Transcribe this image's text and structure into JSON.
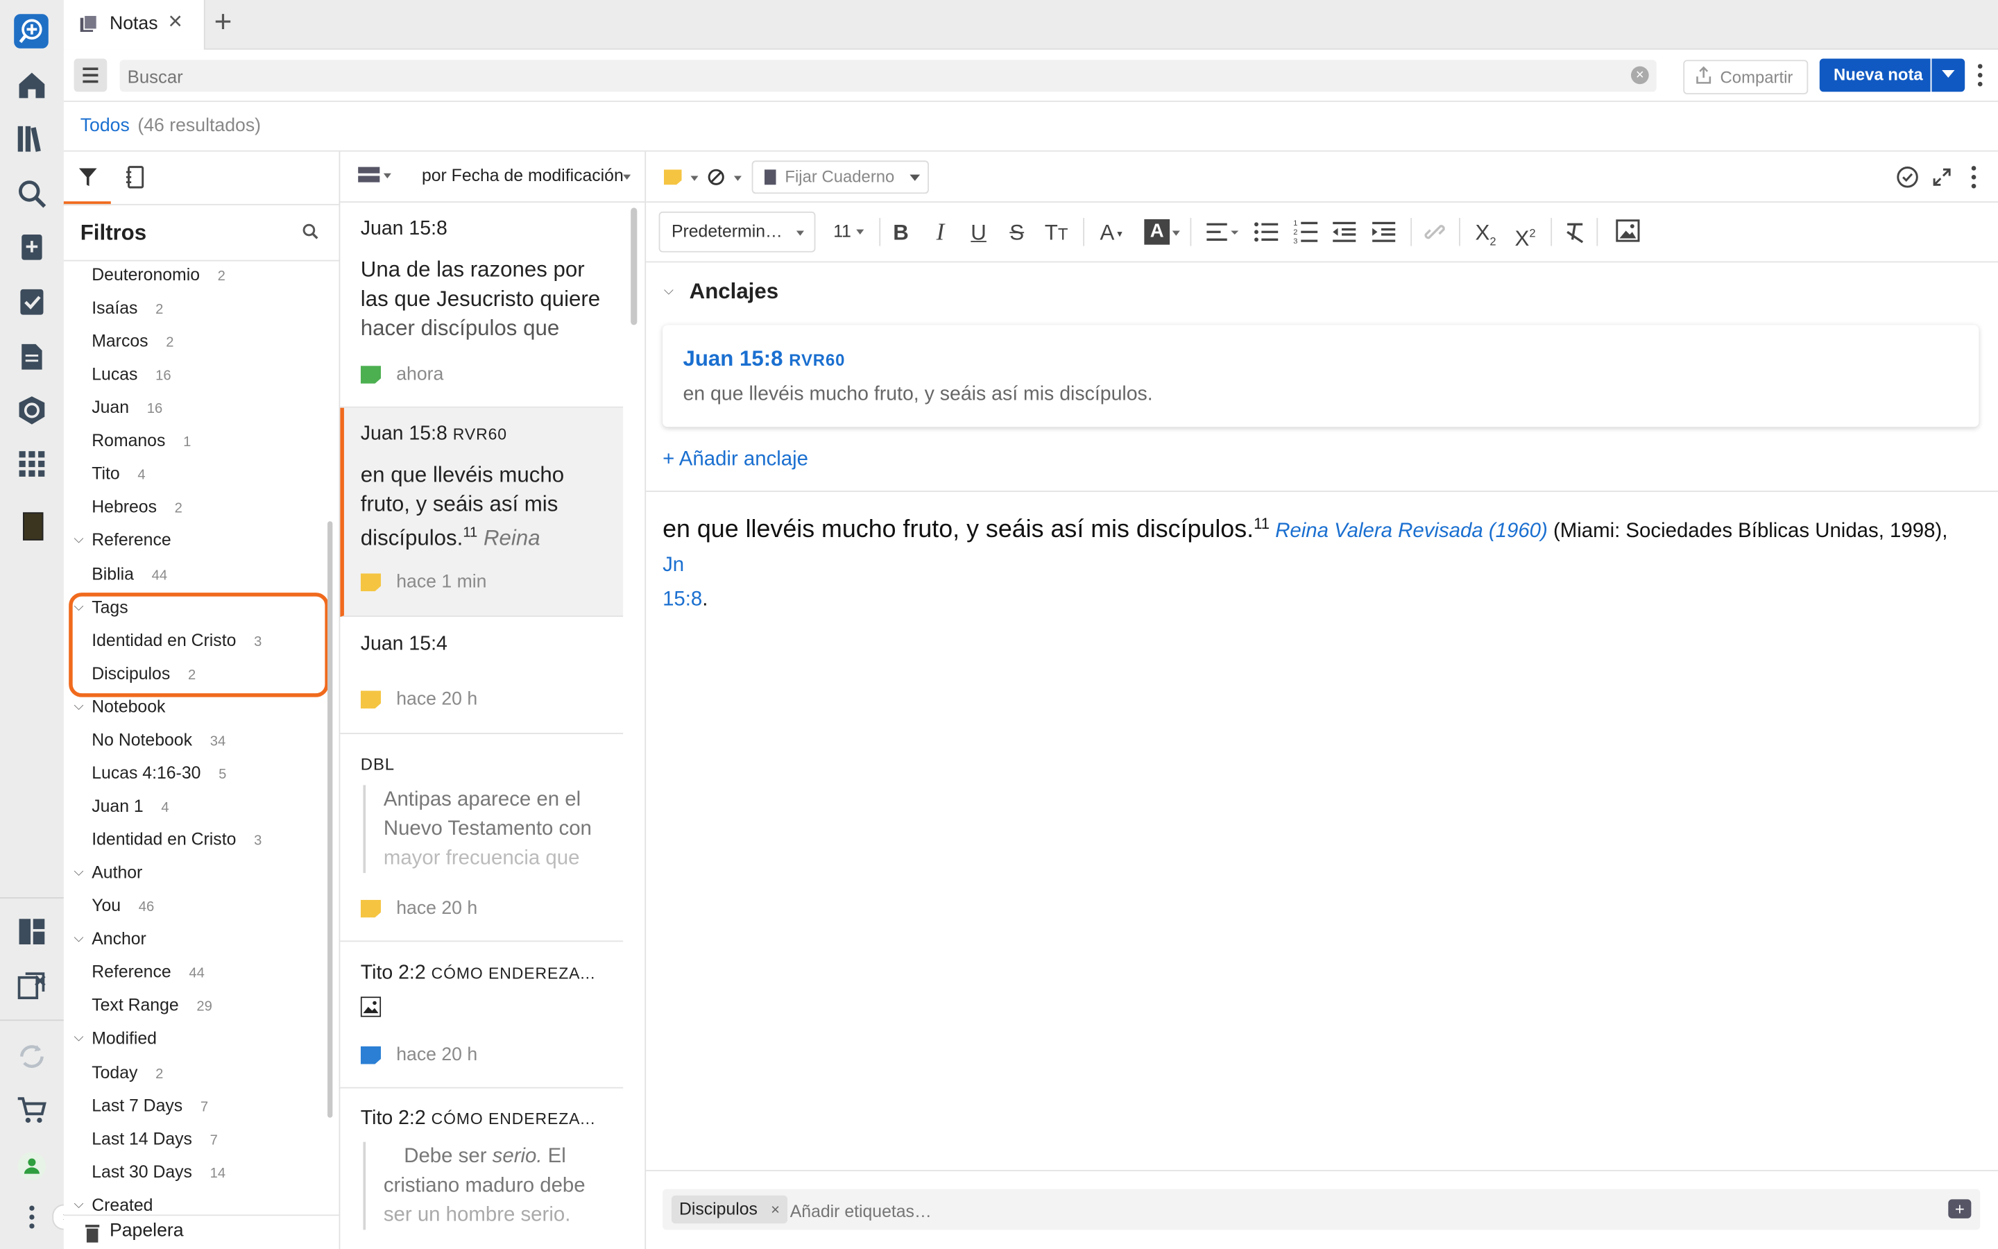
{
  "tab": {
    "title": "Notas"
  },
  "toolbar": {
    "search_placeholder": "Buscar",
    "share_label": "Compartir",
    "new_note_label": "Nueva nota"
  },
  "results": {
    "filter": "Todos",
    "count": "(46 resultados)"
  },
  "filters": {
    "title": "Filtros",
    "rows": [
      {
        "label": "Deuteronomio",
        "count": "2"
      },
      {
        "label": "Isaías",
        "count": "2"
      },
      {
        "label": "Marcos",
        "count": "2"
      },
      {
        "label": "Lucas",
        "count": "16"
      },
      {
        "label": "Juan",
        "count": "16"
      },
      {
        "label": "Romanos",
        "count": "1"
      },
      {
        "label": "Tito",
        "count": "4"
      },
      {
        "label": "Hebreos",
        "count": "2"
      },
      {
        "label": "Reference",
        "count": ""
      },
      {
        "label": "Biblia",
        "count": "44"
      },
      {
        "label": "Tags",
        "count": ""
      },
      {
        "label": "Identidad en Cristo",
        "count": "3"
      },
      {
        "label": "Discipulos",
        "count": "2"
      },
      {
        "label": "Notebook",
        "count": ""
      },
      {
        "label": "No Notebook",
        "count": "34"
      },
      {
        "label": "Lucas 4:16-30",
        "count": "5"
      },
      {
        "label": "Juan 1",
        "count": "4"
      },
      {
        "label": "Identidad en Cristo",
        "count": "3"
      },
      {
        "label": "Author",
        "count": ""
      },
      {
        "label": "You",
        "count": "46"
      },
      {
        "label": "Anchor",
        "count": ""
      },
      {
        "label": "Reference",
        "count": "44"
      },
      {
        "label": "Text Range",
        "count": "29"
      },
      {
        "label": "Modified",
        "count": ""
      },
      {
        "label": "Today",
        "count": "2"
      },
      {
        "label": "Last 7 Days",
        "count": "7"
      },
      {
        "label": "Last 14 Days",
        "count": "7"
      },
      {
        "label": "Last 30 Days",
        "count": "14"
      },
      {
        "label": "Created",
        "count": ""
      }
    ],
    "trash_label": "Papelera"
  },
  "notes_list": {
    "sort_label": "por Fecha de modificación",
    "items": [
      {
        "ref": "Juan 15:8",
        "ref_sc": "",
        "body_l1": "Una de las razones por",
        "body_l2": "las que Jesucristo quiere",
        "body_l3": "hacer discípulos que",
        "time": "ahora",
        "color": "#4caf50"
      },
      {
        "ref": "Juan 15:8",
        "ref_sc": "RVR60",
        "body_l1": "en que llevéis mucho",
        "body_l2": "fruto, y seáis así mis",
        "body_l3": "discípulos.",
        "body_l3_sup": "11",
        "body_l3_it": "Reina",
        "time": "hace 1 min",
        "color": "#f5c542"
      },
      {
        "ref": "Juan 15:4",
        "ref_sc": "",
        "time": "hace 20 h",
        "color": "#f5c542"
      },
      {
        "ref": "",
        "ref_sc": "DBL",
        "quote_l1": "Antipas aparece en el",
        "quote_l2": "Nuevo Testamento con",
        "quote_l3": "mayor frecuencia que",
        "time": "hace 20 h",
        "color": "#f5c542"
      },
      {
        "ref": "Tito 2:2",
        "ref_sc": "CÓMO ENDEREZA...",
        "time": "hace 20 h",
        "color": "#2b7fd4"
      },
      {
        "ref": "Tito 2:2",
        "ref_sc": "CÓMO ENDEREZA...",
        "quote_l1a": "Debe ser ",
        "quote_l1b": "serio.",
        "quote_l1c": " El",
        "quote_l2": "cristiano maduro debe",
        "quote_l3": "ser un hombre serio."
      }
    ]
  },
  "editor": {
    "notebook_placeholder": "Fijar Cuaderno",
    "style_select": "Predetermin…",
    "font_size": "11",
    "anchors_title": "Anclajes",
    "anchor_ref": "Juan 15:8",
    "anchor_version": "RVR60",
    "anchor_text": "en que llevéis mucho fruto, y seáis así mis discípulos.",
    "add_anchor": "+ Añadir anclaje",
    "content_main": "en que llevéis mucho fruto, y seáis así mis discípulos.",
    "content_sup": "11",
    "content_link": "Reina Valera Revisada (1960)",
    "content_pub": " (Miami: Sociedades Bíblicas Unidas, 1998), ",
    "content_ref_a": "Jn",
    "content_ref_b": "15:8",
    "content_end": ".",
    "tag_chip": "Discipulos",
    "tags_placeholder": "Añadir etiquetas…"
  },
  "colors": {
    "accent": "#1a6fd0",
    "primary_button": "#1059c2",
    "highlight_orange": "#f06a1d"
  }
}
